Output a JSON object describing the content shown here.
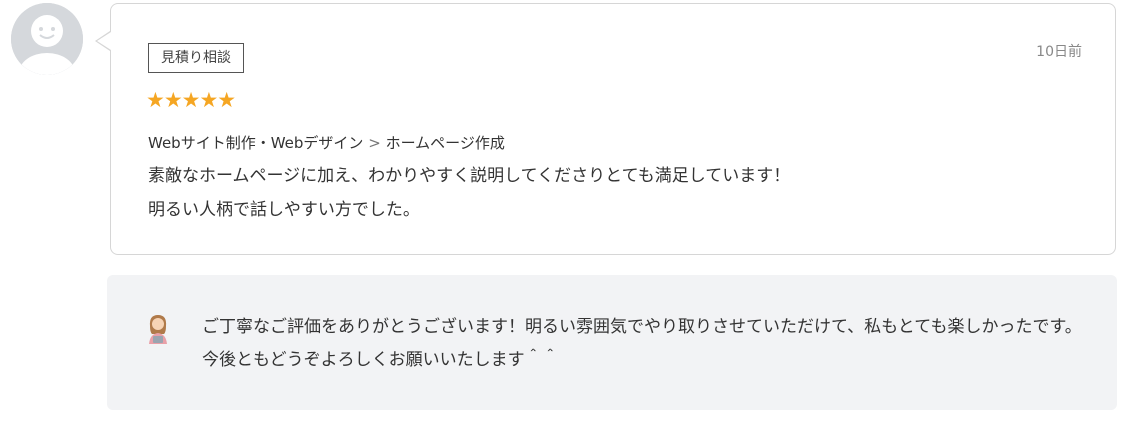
{
  "review": {
    "tag": "見積り相談",
    "date": "10日前",
    "rating": 5,
    "stars": "★★★★★",
    "category": "Webサイト制作・Webデザイン",
    "category_sep": ">",
    "subcategory": "ホームページ作成",
    "lines": [
      "素敵なホームページに加え、わかりやすく説明してくださりとても満足しています！",
      "明るい人柄で話しやすい方でした。"
    ]
  },
  "reply": {
    "text": "ご丁寧なご評価をありがとうございます！明るい雰囲気でやり取りさせていただけて、私もとても楽しかったです。今後ともどうぞよろしくお願いいたします＾＾"
  },
  "colors": {
    "star": "#f5a623",
    "reply_bg": "#f2f3f5",
    "avatar_bg": "#d5d8dc"
  },
  "icons": {
    "reviewer_avatar": "default-user-avatar-icon",
    "seller_avatar": "seller-avatar-icon"
  }
}
